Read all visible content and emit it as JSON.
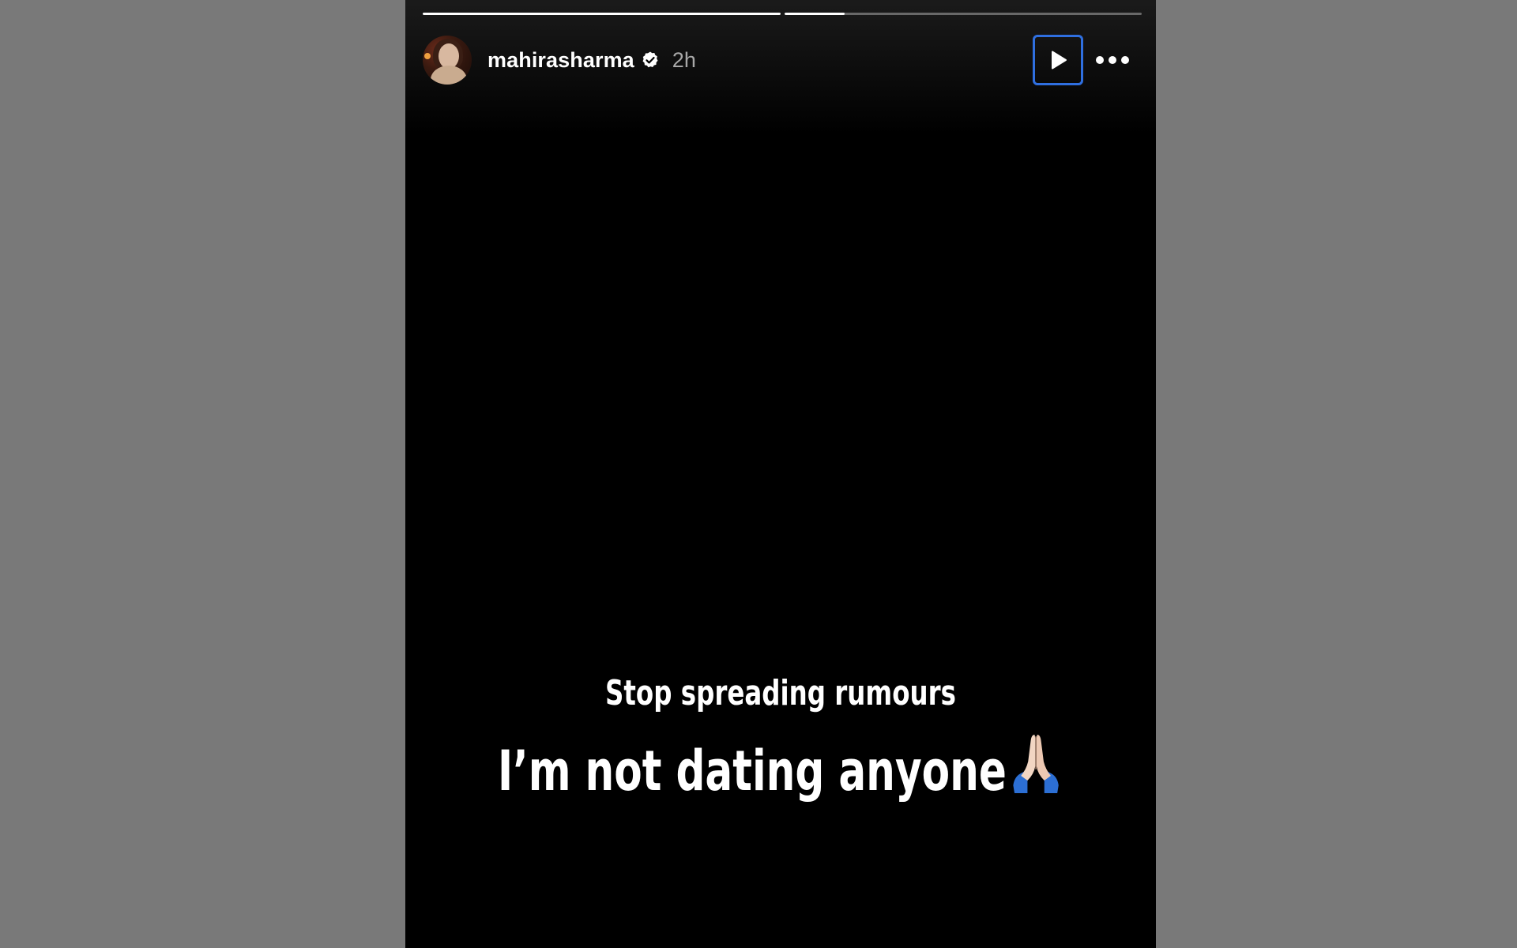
{
  "story": {
    "progress": [
      {
        "segment": 1,
        "fraction": 1.0
      },
      {
        "segment": 2,
        "fraction": 0.17
      }
    ],
    "header": {
      "username": "mahirasharma",
      "verified": true,
      "timestamp": "2h",
      "avatar_icon": "profile-photo",
      "play_icon": "play-icon",
      "more_icon": "more-options-icon"
    },
    "caption": {
      "line1": "Stop spreading rumours",
      "line2": "I’m not dating anyone",
      "emoji_icon": "folded-hands-emoji"
    }
  },
  "colors": {
    "page_background": "#797979",
    "story_background": "#000000",
    "text_primary": "#ffffff",
    "text_secondary": "#a8a8a8",
    "focus_outline": "#2f6fe0"
  }
}
